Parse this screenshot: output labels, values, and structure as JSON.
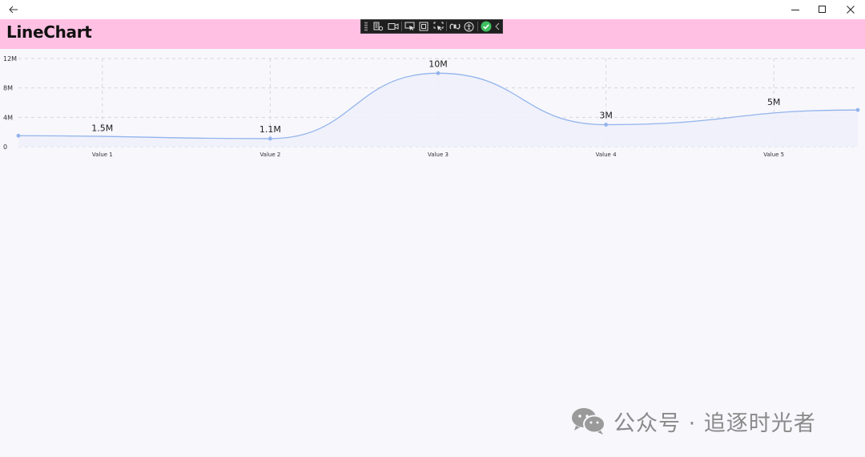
{
  "header": {
    "title": "LineChart"
  },
  "watermark": {
    "text": "公众号 · 追逐时光者"
  },
  "icons": {
    "back": "arrow-left-icon",
    "minimize": "minimize-icon",
    "maximize": "maximize-icon",
    "close": "close-icon",
    "devtools": [
      "live-visual-tree-icon",
      "record-icon",
      "select-element-icon",
      "display-layout-adorners-icon",
      "track-focus-icon",
      "hot-reload-icon",
      "accessibility-icon",
      "status-check-icon",
      "collapse-chevron-icon"
    ]
  },
  "colors": {
    "header_bg": "#ffc0e3",
    "series_line": "#93b4ec",
    "series_fill": "#eef0fb",
    "status_ok": "#3fbf5f"
  },
  "chart_data": {
    "type": "area",
    "categories": [
      "Value 1",
      "Value 2",
      "Value 3",
      "Value 4",
      "Value 5"
    ],
    "x_ticks": [
      {
        "label": "Value 1",
        "index": 0.5
      },
      {
        "label": "Value 2",
        "index": 1.5
      },
      {
        "label": "Value 3",
        "index": 2.5
      },
      {
        "label": "Value 4",
        "index": 3.5
      },
      {
        "label": "Value 5",
        "index": 4.5
      }
    ],
    "points": [
      {
        "x": 0,
        "y": 1500000,
        "label": ""
      },
      {
        "x": 1.5,
        "y": 1100000,
        "label": "1.1M"
      },
      {
        "x": 2.5,
        "y": 10000000,
        "label": "10M"
      },
      {
        "x": 3.5,
        "y": 3000000,
        "label": "3M"
      },
      {
        "x": 5,
        "y": 5000000,
        "label": ""
      }
    ],
    "extra_labels": [
      {
        "x": 0.5,
        "y": 1500000,
        "label": "1.5M"
      },
      {
        "x": 4.5,
        "y": 5000000,
        "label": "5M"
      }
    ],
    "y_ticks": [
      {
        "value": 0,
        "label": "0"
      },
      {
        "value": 4000000,
        "label": "4M"
      },
      {
        "value": 8000000,
        "label": "8M"
      },
      {
        "value": 12000000,
        "label": "12M"
      }
    ],
    "ylim": [
      0,
      12000000
    ],
    "xlim": [
      0,
      5
    ],
    "grid": true,
    "legend": "none",
    "smooth": true
  }
}
